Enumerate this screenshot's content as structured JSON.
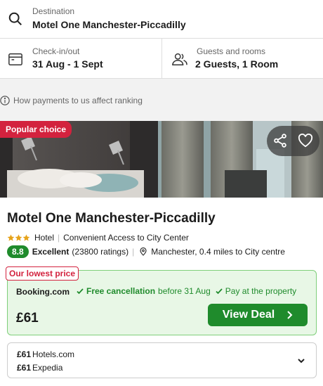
{
  "search": {
    "destination_label": "Destination",
    "destination_value": "Motel One Manchester-Piccadilly",
    "checkin_label": "Check-in/out",
    "checkin_value": "31 Aug - 1 Sept",
    "guests_label": "Guests and rooms",
    "guests_value": "2 Guests, 1 Room"
  },
  "ranking_note": "How payments to us affect ranking",
  "hotel": {
    "badge": "Popular choice",
    "name": "Motel One Manchester-Piccadilly",
    "stars": 3,
    "type": "Hotel",
    "tagline": "Convenient Access to City Center",
    "rating_score": "8.8",
    "rating_word": "Excellent",
    "rating_count": "(23800 ratings)",
    "location": "Manchester, 0.4 miles to City centre"
  },
  "deal": {
    "tag": "Our lowest price",
    "provider": "Booking.com",
    "free_cancel": "Free cancellation",
    "free_cancel_suffix": "before 31 Aug",
    "pay_at_property": "Pay at the property",
    "price": "£61",
    "button_label": "View Deal"
  },
  "other_deals": [
    {
      "price": "£61",
      "provider": "Hotels.com"
    },
    {
      "price": "£61",
      "provider": "Expedia"
    }
  ],
  "colors": {
    "accent_green": "#1f8b2c",
    "badge_red": "#d3223e",
    "deal_bg": "#e8f7e6"
  },
  "icons": [
    "search-icon",
    "calendar-icon",
    "people-icon",
    "info-icon",
    "share-icon",
    "heart-icon",
    "star-icon",
    "map-pin-icon",
    "check-icon",
    "chevron-right-icon",
    "chevron-down-icon"
  ]
}
